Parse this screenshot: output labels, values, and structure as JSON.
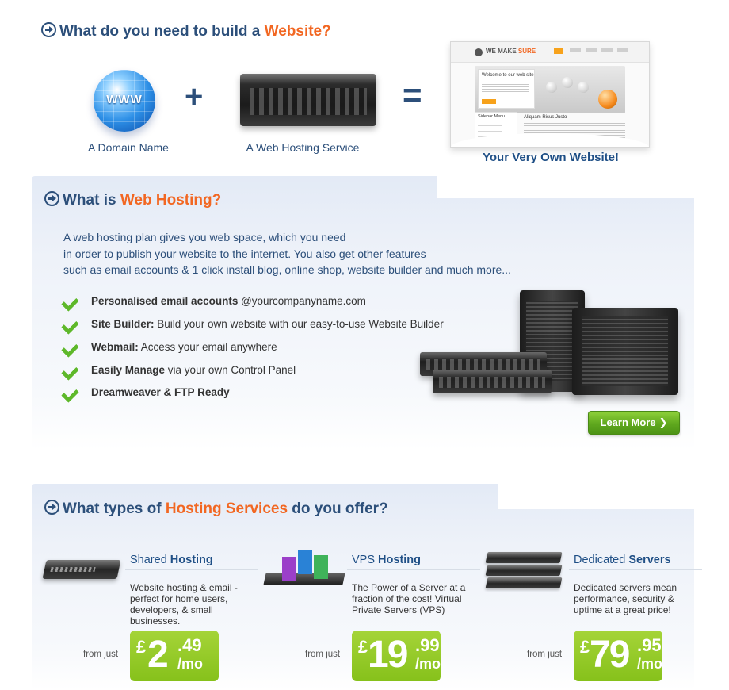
{
  "section1": {
    "heading_prefix": "What do you need to build a ",
    "heading_highlight": "Website?",
    "domain_icon_text": "WWW",
    "plus": "+",
    "equals": "=",
    "domain_caption": "A Domain Name",
    "hosting_caption": "A Web Hosting Service",
    "result_caption": "Your Very Own Website!",
    "preview": {
      "logo_prefix": "WE MAKE ",
      "logo_highlight": "SURE",
      "hero_title": "Welcome to our web site",
      "sidebar_title": "Sidebar Menu",
      "article_title": "Aliquam Risus Justo"
    }
  },
  "section2": {
    "heading_prefix": "What is ",
    "heading_highlight": "Web Hosting?",
    "intro_lines": [
      "A web hosting plan gives you web space, which you need",
      "in order to publish your website to the internet. You also get other features",
      "such as email accounts & 1 click install blog, online shop, website builder and much more..."
    ],
    "features": [
      {
        "bold": "Personalised email accounts",
        "text": " @yourcompanyname.com"
      },
      {
        "bold": "Site Builder:",
        "text": " Build your own website with our easy-to-use Website Builder"
      },
      {
        "bold": "Webmail:",
        "text": " Access your email anywhere"
      },
      {
        "bold": "Easily Manage",
        "text": " via your own Control Panel"
      },
      {
        "bold": "Dreamweaver & FTP Ready",
        "text": ""
      }
    ],
    "learn_more_label": "Learn More",
    "learn_more_chevron": "❯"
  },
  "section3": {
    "heading_prefix": "What types of ",
    "heading_highlight": "Hosting Services",
    "heading_suffix": " do you offer?",
    "services": [
      {
        "title_normal": "Shared ",
        "title_bold": "Hosting",
        "description": "Website hosting & email - perfect for home users, developers, & small businesses.",
        "from_label": "from just",
        "currency": "£",
        "price_main": "2",
        "price_cents": ".49",
        "price_period": "/mo"
      },
      {
        "title_normal": "VPS ",
        "title_bold": "Hosting",
        "description": "The Power of a Server at a fraction of the cost! Virtual Private Servers (VPS)",
        "from_label": "from just",
        "currency": "£",
        "price_main": "19",
        "price_cents": ".99",
        "price_period": "/mo"
      },
      {
        "title_normal": "Dedicated ",
        "title_bold": "Servers",
        "description": "Dedicated servers mean performance, security & uptime at a great price!",
        "from_label": "from just",
        "currency": "£",
        "price_main": "79",
        "price_cents": ".95",
        "price_period": "/mo"
      }
    ]
  },
  "colors": {
    "heading_blue": "#2c4f7a",
    "highlight_orange": "#f26722",
    "price_green": "#86c11b",
    "check_green": "#5eb82a"
  }
}
